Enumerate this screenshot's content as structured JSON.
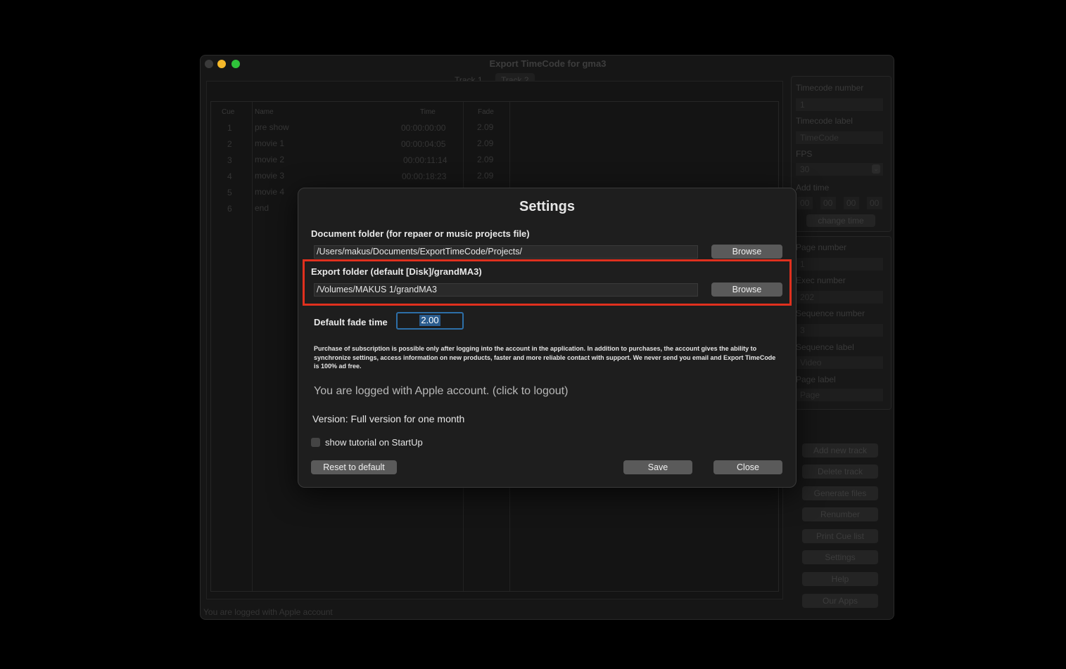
{
  "window": {
    "title": "Export TimeCode for gma3",
    "tabs": [
      "Track 1",
      "Track 2"
    ],
    "status": "You are logged with Apple account"
  },
  "table": {
    "headers": [
      "Cue",
      "Name",
      "Time",
      "Fade"
    ],
    "rows": [
      {
        "cue": "1",
        "name": "pre show",
        "time": "00:00:00:00",
        "fade": "2.09"
      },
      {
        "cue": "2",
        "name": "movie 1",
        "time": "00:00:04:05",
        "fade": "2.09"
      },
      {
        "cue": "3",
        "name": "movie 2",
        "time": "00:00:11:14",
        "fade": "2.09"
      },
      {
        "cue": "4",
        "name": "movie 3",
        "time": "00:00:18:23",
        "fade": "2.09"
      },
      {
        "cue": "5",
        "name": "movie 4",
        "time": "",
        "fade": ""
      },
      {
        "cue": "6",
        "name": "end",
        "time": "",
        "fade": ""
      }
    ]
  },
  "timecode_panel": {
    "tc_number_label": "Timecode number",
    "tc_number": "1",
    "tc_label_label": "Timecode label",
    "tc_label": "TimeCode",
    "fps_label": "FPS",
    "fps": "30",
    "add_time_label": "Add time",
    "add_time": [
      "00",
      "00",
      "00",
      "00"
    ],
    "change_time": "change time"
  },
  "page_panel": {
    "page_number_label": "Page number",
    "page_number": "1",
    "exec_number_label": "Exec number",
    "exec_number": "202",
    "sequence_number_label": "Sequence number",
    "sequence_number": "3",
    "sequence_label_label": "Sequence label",
    "sequence_label": "Video",
    "page_label_label": "Page label",
    "page_label": "Page"
  },
  "side_buttons": [
    "Add new track",
    "Delete track",
    "Generate files",
    "Renumber",
    "Print Cue list",
    "Settings",
    "Help",
    "Our Apps"
  ],
  "dialog": {
    "title": "Settings",
    "doc_folder_label": "Document folder (for repaer or music projects file)",
    "doc_folder_path": "/Users/makus/Documents/ExportTimeCode/Projects/",
    "browse": "Browse",
    "export_folder_label": "Export folder (default [Disk]/grandMA3)",
    "export_folder_path": "/Volumes/MAKUS 1/grandMA3",
    "fade_label": "Default fade time",
    "fade_value": "2.00",
    "note": "Purchase of subscription is possible only after logging into the account in the application. In addition to purchases, the account gives the ability to synchronize settings, access information on new products, faster and more reliable contact with support. We never send you email and Export TimeCode is 100% ad free.",
    "login_status": "You are logged with Apple account. (click to logout)",
    "version": "Version: Full version for one month",
    "tutorial_checkbox": "show tutorial on StartUp",
    "reset": "Reset to default",
    "save": "Save",
    "close": "Close"
  },
  "colors": {
    "highlight": "#e0301e",
    "input_focus": "#2d6fa8"
  }
}
